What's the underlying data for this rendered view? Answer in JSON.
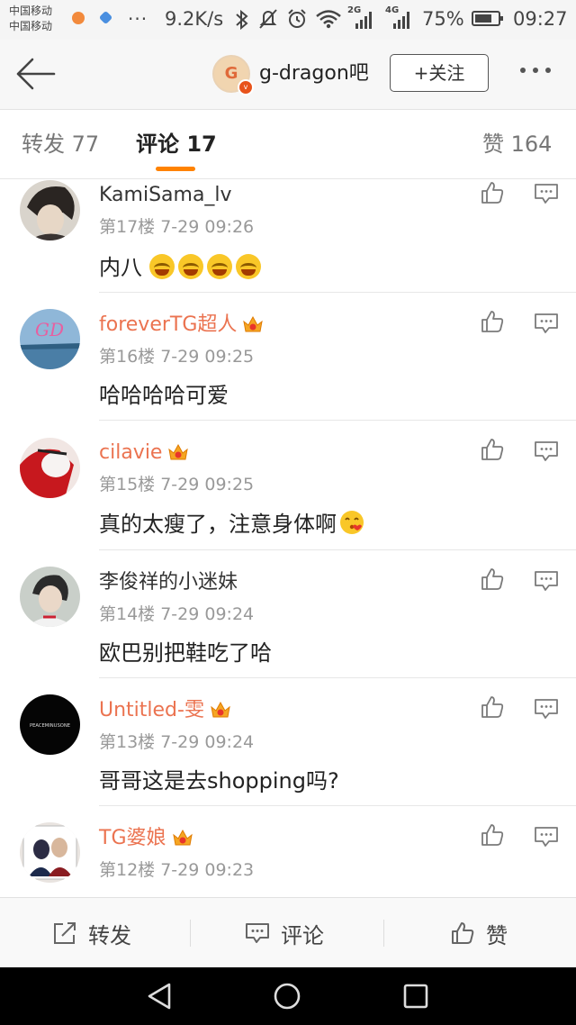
{
  "status_bar": {
    "carrier1": "中国移动",
    "carrier2": "中国移动",
    "more": "···",
    "speed": "9.2K/s",
    "net1": "2G",
    "net2": "4G",
    "battery_text": "75%",
    "battery_level": 0.75,
    "time": "09:27"
  },
  "header": {
    "avatar_letter": "G",
    "badge": "v",
    "title": "g-dragon吧",
    "follow_label": "+关注"
  },
  "tabs": [
    {
      "label": "转发 77"
    },
    {
      "label": "评论 17"
    },
    {
      "label": "赞 164"
    }
  ],
  "accent_color": "#ff8200",
  "name_highlight_color": "#eb7350",
  "comments": [
    {
      "user": "KamiSama_lv",
      "meta": "第17楼 7-29 09:26",
      "text": "内八",
      "emoji_count": 4
    },
    {
      "user": "foreverTG超人",
      "meta": "第16楼 7-29 09:25",
      "text": "哈哈哈哈可爱",
      "member": true
    },
    {
      "user": "cilavie",
      "meta": "第15楼 7-29 09:25",
      "text": "真的太瘦了，注意身体啊",
      "member": true,
      "trailing_emoji": "kiss-face"
    },
    {
      "user": "李俊祥的小迷妹",
      "meta": "第14楼 7-29 09:24",
      "text": "欧巴别把鞋吃了哈"
    },
    {
      "user": "Untitled-雯",
      "meta": "第13楼 7-29 09:24",
      "text": "哥哥这是去shopping吗?",
      "member": true
    },
    {
      "user": "TG婆娘",
      "meta": "第12楼 7-29 09:23",
      "text": "",
      "member": true
    }
  ],
  "avatar_texts": {
    "untitled": "PEACEMINUSONE"
  },
  "actions": {
    "repost": "转发",
    "comment": "评论",
    "like": "赞"
  }
}
